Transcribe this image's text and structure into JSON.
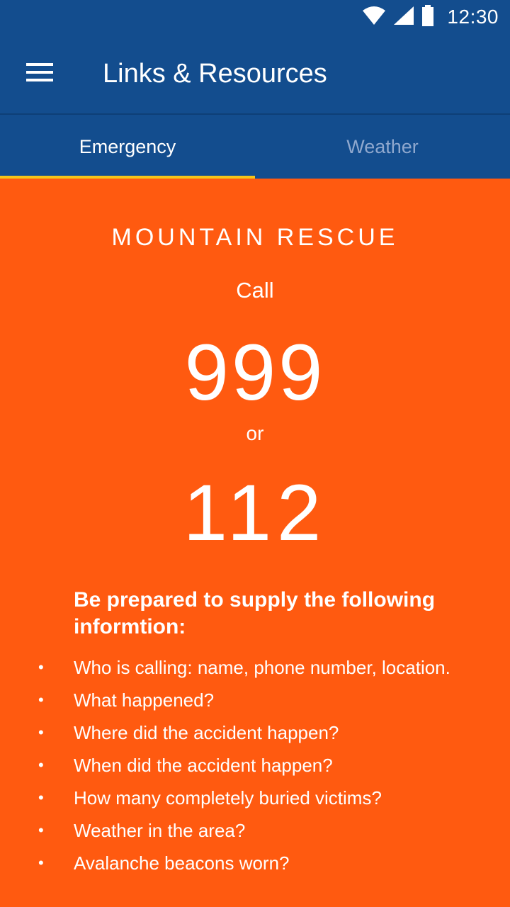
{
  "status_bar": {
    "time": "12:30",
    "icons": [
      "wifi-icon",
      "signal-icon",
      "battery-icon"
    ]
  },
  "toolbar": {
    "menu_icon": "hamburger-menu-icon",
    "title": "Links & Resources"
  },
  "tabs": [
    {
      "label": "Emergency",
      "active": true
    },
    {
      "label": "Weather",
      "active": false
    }
  ],
  "content": {
    "heading": "MOUNTAIN RESCUE",
    "call_label": "Call",
    "primary_number": "999",
    "or_label": "or",
    "secondary_number": "112",
    "instructions": "Be prepared to supply the following informtion:",
    "checklist": [
      "Who is calling: name, phone number, location.",
      "What happened?",
      "Where did the accident happen?",
      "When did the accident happen?",
      "How many completely buried victims?",
      "Weather in the area?",
      "Avalanche beacons worn?"
    ],
    "bullet": "•"
  },
  "colors": {
    "app_bar": "#134D8E",
    "background": "#FF5A10",
    "tab_indicator": "#F5C518",
    "inactive_tab_text": "#8FA8CE",
    "text": "#FFFFFF"
  }
}
